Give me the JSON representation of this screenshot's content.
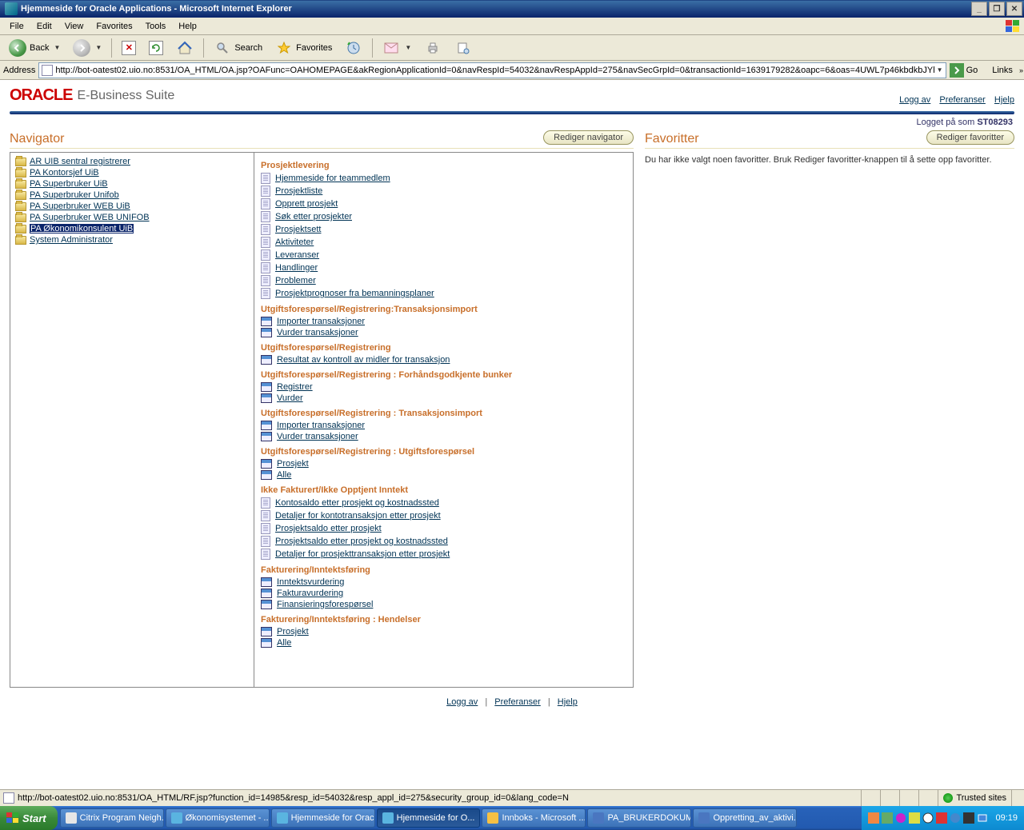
{
  "window": {
    "title": "Hjemmeside for Oracle Applications - Microsoft Internet Explorer"
  },
  "menubar": [
    "File",
    "Edit",
    "View",
    "Favorites",
    "Tools",
    "Help"
  ],
  "toolbar": {
    "back": "Back",
    "search": "Search",
    "favorites": "Favorites"
  },
  "addrbar": {
    "label": "Address",
    "url": "http://bot-oatest02.uio.no:8531/OA_HTML/OA.jsp?OAFunc=OAHOMEPAGE&akRegionApplicationId=0&navRespId=54032&navRespAppId=275&navSecGrpId=0&transactionId=1639179282&oapc=6&oas=4UWL7p46kbdkbJYl",
    "go": "Go",
    "links": "Links"
  },
  "oracle": {
    "logo": "ORACLE",
    "suite": "E-Business Suite",
    "links": {
      "logoff": "Logg av",
      "prefs": "Preferanser",
      "help": "Hjelp"
    },
    "login_prefix": "Logget på som ",
    "login_user": "ST08293"
  },
  "navigator": {
    "title": "Navigator",
    "edit_btn": "Rediger navigator",
    "folders": [
      {
        "label": "AR UIB sentral registrerer",
        "selected": false
      },
      {
        "label": "PA Kontorsjef UiB",
        "selected": false
      },
      {
        "label": "PA Superbruker UiB",
        "selected": false
      },
      {
        "label": "PA Superbruker Unifob",
        "selected": false
      },
      {
        "label": "PA Superbruker WEB UiB",
        "selected": false
      },
      {
        "label": "PA Superbruker WEB UNIFOB",
        "selected": false
      },
      {
        "label": "PA Økonomikonsulent UiB",
        "selected": true
      },
      {
        "label": "System Administrator",
        "selected": false
      }
    ],
    "sections": [
      {
        "title": "Prosjektlevering",
        "links": [
          {
            "t": "doc",
            "l": "Hjemmeside for teammedlem"
          },
          {
            "t": "doc",
            "l": "Prosjektliste"
          },
          {
            "t": "doc",
            "l": "Opprett prosjekt"
          },
          {
            "t": "doc",
            "l": "Søk etter prosjekter"
          },
          {
            "t": "doc",
            "l": "Prosjektsett"
          },
          {
            "t": "doc",
            "l": "Aktiviteter"
          },
          {
            "t": "doc",
            "l": "Leveranser"
          },
          {
            "t": "doc",
            "l": "Handlinger"
          },
          {
            "t": "doc",
            "l": "Problemer"
          },
          {
            "t": "doc",
            "l": "Prosjektprognoser fra bemanningsplaner"
          }
        ]
      },
      {
        "title": "Utgiftsforespørsel/Registrering:Transaksjonsimport",
        "links": [
          {
            "t": "form",
            "l": "Importer transaksjoner"
          },
          {
            "t": "form",
            "l": "Vurder transaksjoner"
          }
        ]
      },
      {
        "title": "Utgiftsforespørsel/Registrering",
        "links": [
          {
            "t": "form",
            "l": "Resultat av kontroll av midler for transaksjon"
          }
        ]
      },
      {
        "title": "Utgiftsforespørsel/Registrering : Forhåndsgodkjente bunker",
        "links": [
          {
            "t": "form",
            "l": "Registrer"
          },
          {
            "t": "form",
            "l": "Vurder"
          }
        ]
      },
      {
        "title": "Utgiftsforespørsel/Registrering : Transaksjonsimport",
        "links": [
          {
            "t": "form",
            "l": "Importer transaksjoner"
          },
          {
            "t": "form",
            "l": "Vurder transaksjoner"
          }
        ]
      },
      {
        "title": "Utgiftsforespørsel/Registrering : Utgiftsforespørsel",
        "links": [
          {
            "t": "form",
            "l": "Prosjekt"
          },
          {
            "t": "form",
            "l": "Alle"
          }
        ]
      },
      {
        "title": "Ikke Fakturert/Ikke Opptjent Inntekt",
        "links": [
          {
            "t": "doc",
            "l": "Kontosaldo etter prosjekt og kostnadssted"
          },
          {
            "t": "doc",
            "l": "Detaljer for kontotransaksjon etter prosjekt"
          },
          {
            "t": "doc",
            "l": "Prosjektsaldo etter prosjekt"
          },
          {
            "t": "doc",
            "l": "Prosjektsaldo etter prosjekt og kostnadssted"
          },
          {
            "t": "doc",
            "l": "Detaljer for prosjekttransaksjon etter prosjekt"
          }
        ]
      },
      {
        "title": "Fakturering/Inntektsføring",
        "links": [
          {
            "t": "form",
            "l": "Inntektsvurdering"
          },
          {
            "t": "form",
            "l": "Fakturavurdering"
          },
          {
            "t": "form",
            "l": "Finansieringsforespørsel"
          }
        ]
      },
      {
        "title": "Fakturering/Inntektsføring : Hendelser",
        "links": [
          {
            "t": "form",
            "l": "Prosjekt"
          },
          {
            "t": "form",
            "l": "Alle"
          }
        ]
      }
    ]
  },
  "favorites": {
    "title": "Favoritter",
    "edit_btn": "Rediger favoritter",
    "empty_text": "Du har ikke valgt noen favoritter. Bruk Rediger favoritter-knappen til å sette opp favoritter."
  },
  "footer": {
    "logoff": "Logg av",
    "prefs": "Preferanser",
    "help": "Hjelp",
    "sep": "|"
  },
  "statusbar": {
    "text": "http://bot-oatest02.uio.no:8531/OA_HTML/RF.jsp?function_id=14985&resp_id=54032&resp_appl_id=275&security_group_id=0&lang_code=N",
    "trusted": "Trusted sites"
  },
  "taskbar": {
    "start": "Start",
    "buttons": [
      {
        "l": "Citrix Program Neigh...",
        "a": false,
        "c": "#e6e6e6"
      },
      {
        "l": "Økonomisystemet - ...",
        "a": false,
        "c": "#5ab4e0"
      },
      {
        "l": "Hjemmeside for Orac...",
        "a": false,
        "c": "#5ab4e0"
      },
      {
        "l": "Hjemmeside for O...",
        "a": true,
        "c": "#5ab4e0"
      },
      {
        "l": "Innboks - Microsoft ...",
        "a": false,
        "c": "#f6c044"
      },
      {
        "l": "PA_BRUKERDOKUME...",
        "a": false,
        "c": "#4a76c0"
      },
      {
        "l": "Oppretting_av_aktivi...",
        "a": false,
        "c": "#4a76c0"
      }
    ],
    "time": "09:19"
  }
}
